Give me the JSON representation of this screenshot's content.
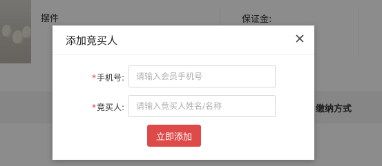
{
  "background": {
    "type_label": "摆件",
    "deposit_label": "保证金:",
    "column_header_payment": "缴纳方式"
  },
  "modal": {
    "title": "添加竞买人",
    "fields": [
      {
        "required_mark": "*",
        "label": "手机号:",
        "placeholder": "请输入会员手机号",
        "value": ""
      },
      {
        "required_mark": "*",
        "label": "竞买人:",
        "placeholder": "请输入竞买人姓名/名称",
        "value": ""
      }
    ],
    "submit_label": "立即添加",
    "close_icon": "close-icon"
  },
  "colors": {
    "accent": "#dd4a48",
    "required": "#e4393c"
  }
}
